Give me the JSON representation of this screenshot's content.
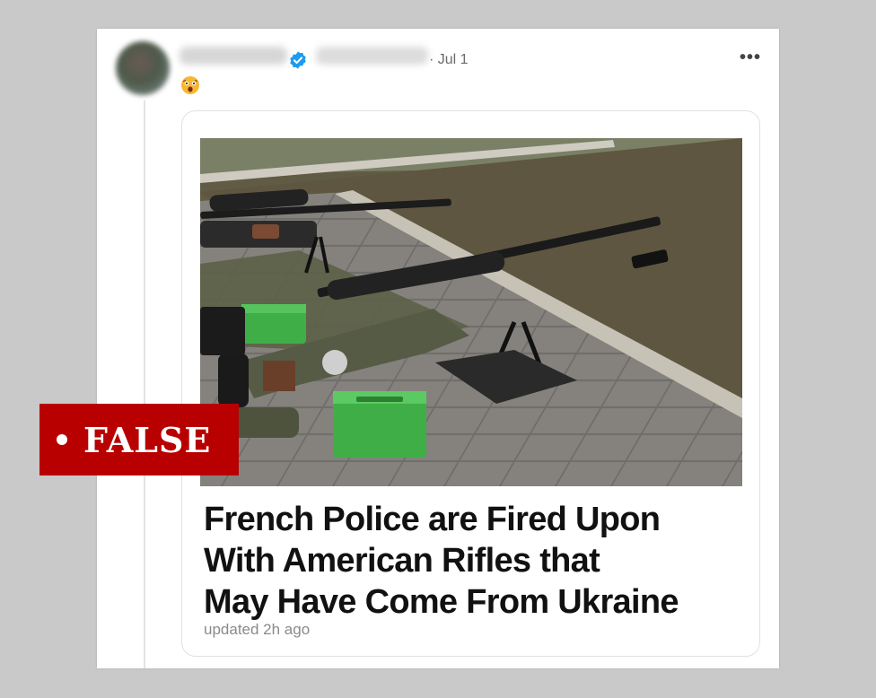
{
  "post": {
    "date": "· Jul 1",
    "more_icon": "more-horizontal-icon",
    "verified_icon": "verified-badge-icon",
    "emoji_icon": "astonished-face-emoji",
    "colors": {
      "verified": "#1d9bf0",
      "text_muted": "#6b6b6b"
    }
  },
  "link_card": {
    "headline_lines": [
      "French Police are Fired Upon",
      "With American Rifles that",
      "May Have Come From Ukraine"
    ],
    "updated": "updated 2h ago"
  },
  "false_label": {
    "text": "FALSE",
    "color": "#b80000"
  }
}
